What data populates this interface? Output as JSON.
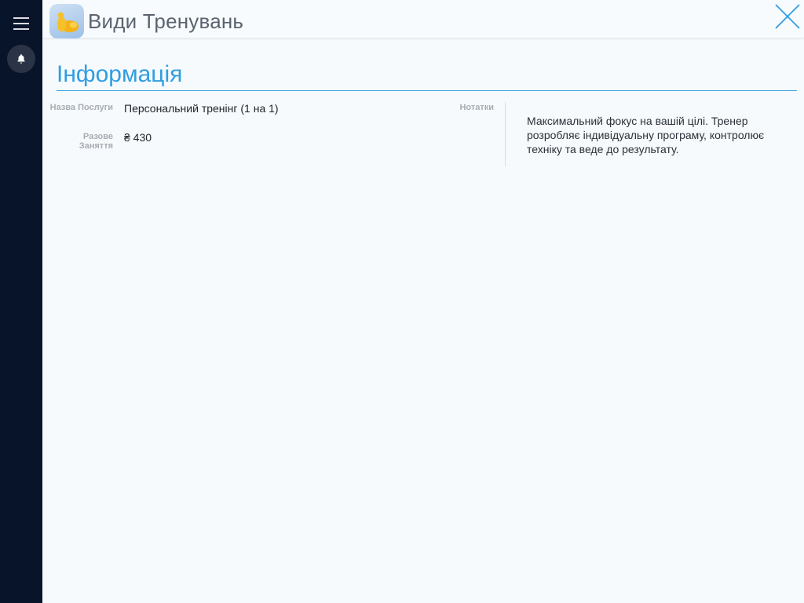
{
  "header": {
    "title": "Види Тренувань",
    "close_icon": "close-icon",
    "app_icon": "flexed-biceps-icon"
  },
  "sidebar": {
    "menu_icon": "hamburger-menu-icon",
    "notifications_icon": "bell-icon"
  },
  "section": {
    "title": "Інформація"
  },
  "fields": {
    "service_name_label": "Назва Послуги",
    "service_name_value": "Персональний тренінг (1 на 1)",
    "single_session_label": "Разове Заняття",
    "single_session_value": "₴ 430",
    "notes_label": "Нотатки",
    "notes_value": "Максимальний фокус на вашій цілі. Тренер розробляє індивідуальну програму, контролює техніку та веде до результату."
  },
  "colors": {
    "sidebar_bg": "#08142a",
    "accent": "#2f9ee2",
    "background": "#f6fafc"
  }
}
